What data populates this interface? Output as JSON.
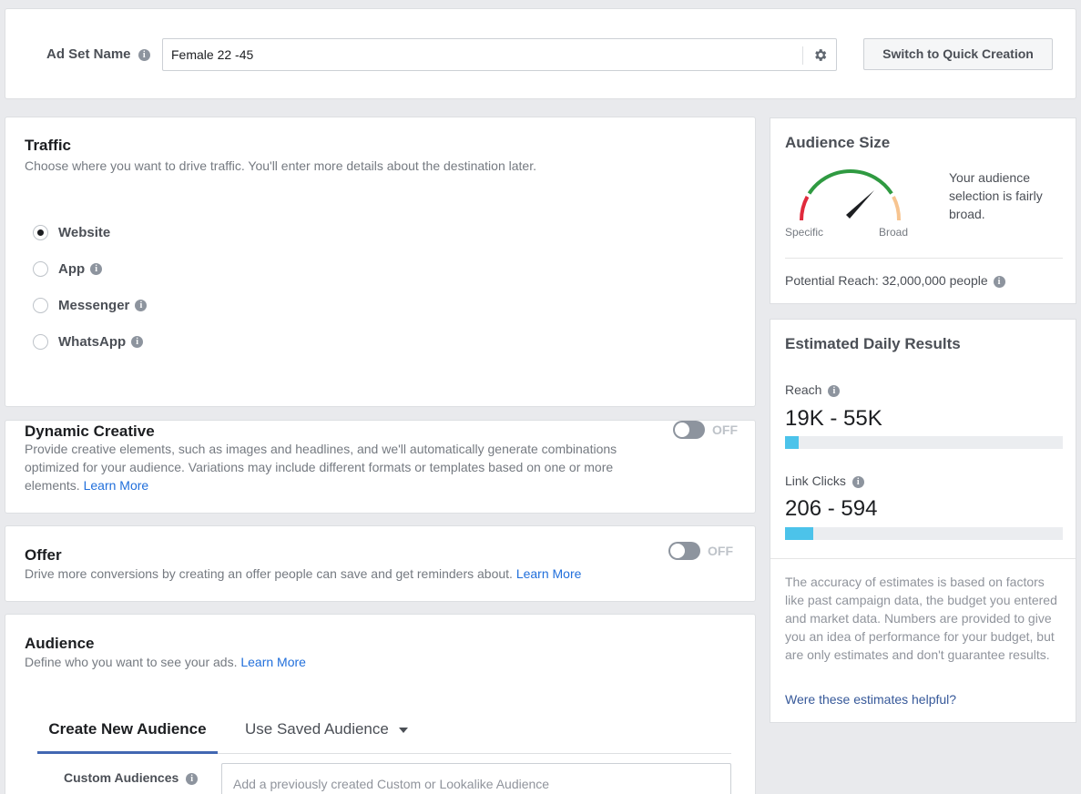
{
  "adset": {
    "label": "Ad Set Name",
    "value": "Female 22 -45",
    "switch_label": "Switch to Quick Creation"
  },
  "traffic": {
    "title": "Traffic",
    "subtitle": "Choose where you want to drive traffic. You'll enter more details about the destination later.",
    "options": [
      {
        "label": "Website",
        "selected": true
      },
      {
        "label": "App",
        "selected": false
      },
      {
        "label": "Messenger",
        "selected": false
      },
      {
        "label": "WhatsApp",
        "selected": false
      }
    ]
  },
  "dynamic_creative": {
    "title": "Dynamic Creative",
    "desc": "Provide creative elements, such as images and headlines, and we'll automatically generate combinations optimized for your audience. Variations may include different formats or templates based on one or more elements.",
    "learn_more": "Learn More",
    "toggle_label": "OFF"
  },
  "offer": {
    "title": "Offer",
    "desc": "Drive more conversions by creating an offer people can save and get reminders about.",
    "learn_more": "Learn More",
    "toggle_label": "OFF"
  },
  "audience": {
    "title": "Audience",
    "desc": "Define who you want to see your ads.",
    "learn_more": "Learn More",
    "tabs": [
      "Create New Audience",
      "Use Saved Audience"
    ],
    "custom_label": "Custom Audiences",
    "custom_placeholder": "Add a previously created Custom or Lookalike Audience"
  },
  "audience_size": {
    "title": "Audience Size",
    "desc": "Your audience selection is fairly broad.",
    "specific": "Specific",
    "broad": "Broad",
    "reach_label": "Potential Reach:",
    "reach_value": "32,000,000 people"
  },
  "estimates": {
    "title": "Estimated Daily Results",
    "reach_label": "Reach",
    "reach_value": "19K - 55K",
    "reach_fill": 0.05,
    "clicks_label": "Link Clicks",
    "clicks_value": "206 - 594",
    "clicks_fill": 0.1,
    "note": "The accuracy of estimates is based on factors like past campaign data, the budget you entered and market data. Numbers are provided to give you an idea of performance for your budget, but are only estimates and don't guarantee results.",
    "helpful": "Were these estimates helpful?"
  },
  "colors": {
    "accent": "#216fdb",
    "bar_fill": "#4cc3ea",
    "gauge_green": "#2f9a41",
    "gauge_red": "#e02a3c",
    "gauge_peach": "#f7c490"
  }
}
